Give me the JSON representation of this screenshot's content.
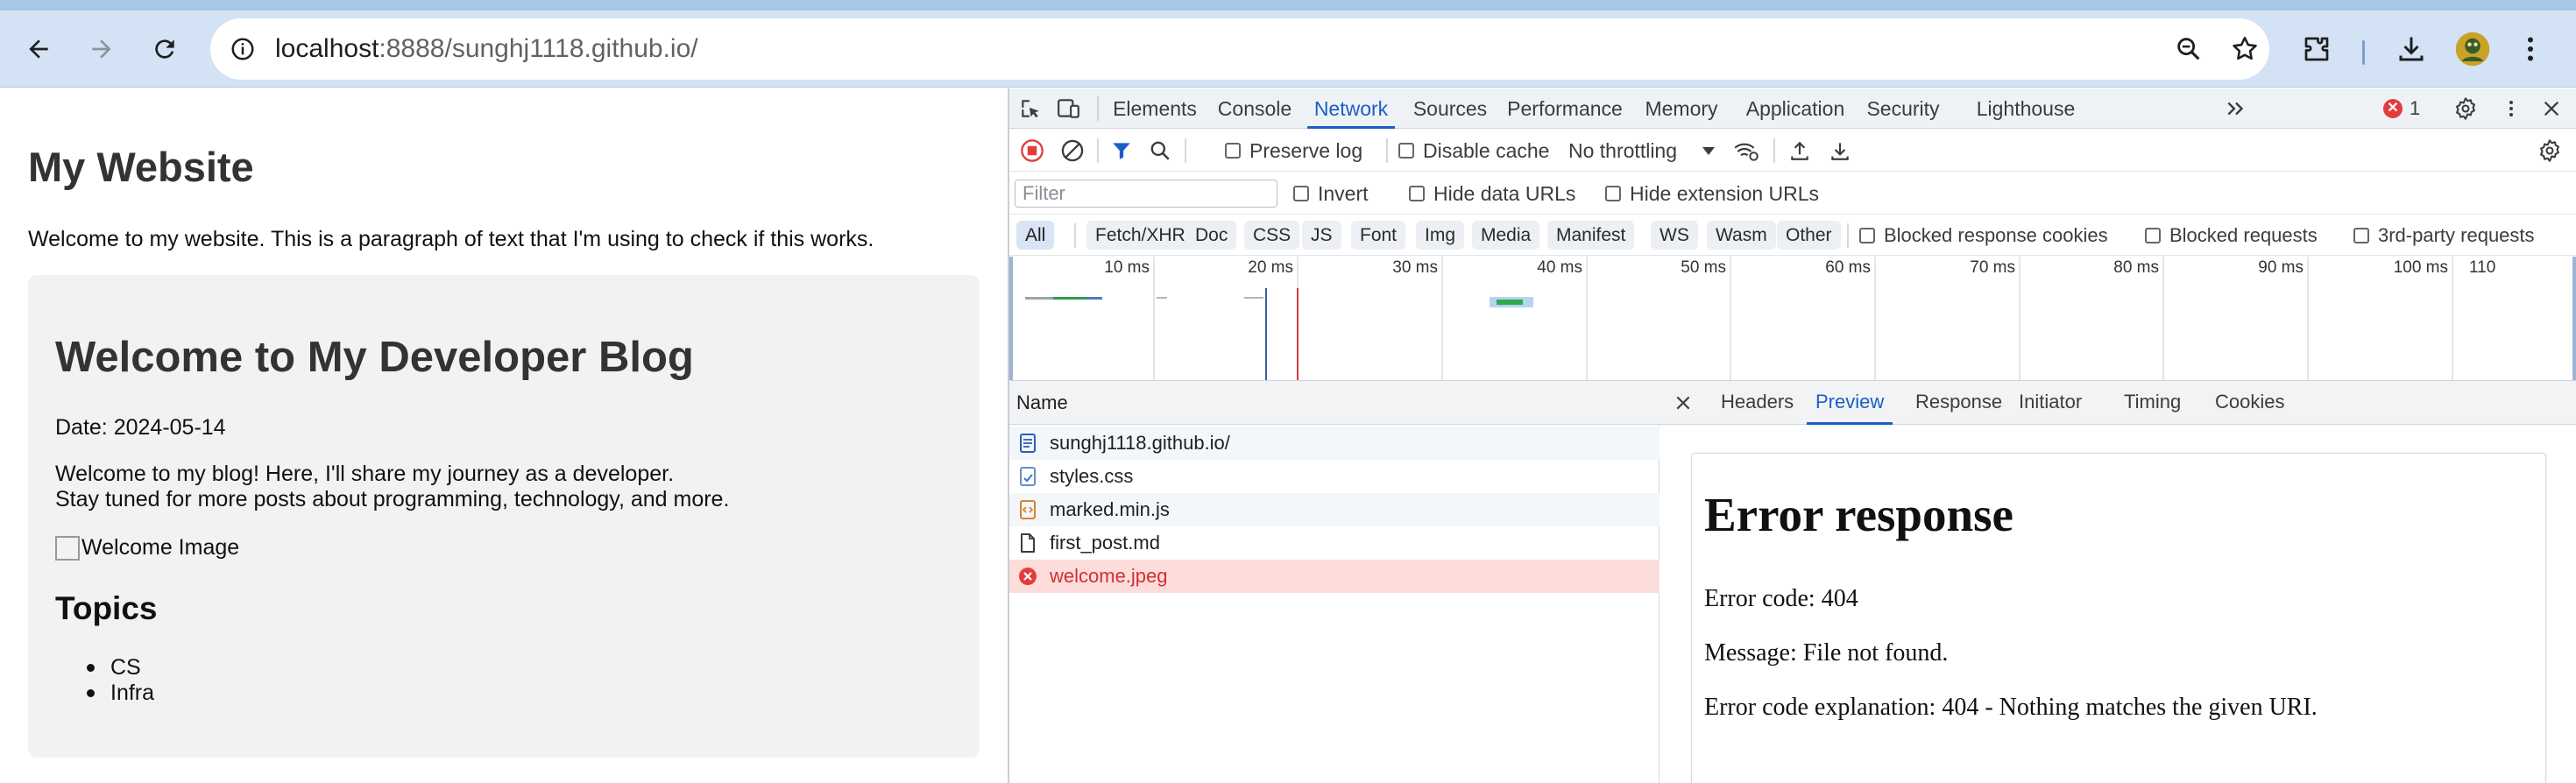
{
  "browser": {
    "url_host": "localhost",
    "url_rest": ":8888/sunghj1118.github.io/"
  },
  "page": {
    "heading": "My Website",
    "intro": "Welcome to my website. This is a paragraph of text that I'm using to check if this works.",
    "blog": {
      "title": "Welcome to My Developer Blog",
      "date": "Date: 2024-05-14",
      "paragraph_line1": "Welcome to my blog! Here, I'll share my journey as a developer.",
      "paragraph_line2": "Stay tuned for more posts about programming, technology, and more.",
      "image_alt": "Welcome Image",
      "topics_title": "Topics",
      "topics": [
        "CS",
        "Infra"
      ]
    }
  },
  "devtools": {
    "tabs": [
      "Elements",
      "Console",
      "Network",
      "Sources",
      "Performance",
      "Memory",
      "Application",
      "Security",
      "Lighthouse"
    ],
    "active_tab": "Network",
    "error_count": "1",
    "toolbar": {
      "preserve_log": "Preserve log",
      "disable_cache": "Disable cache",
      "throttling": "No throttling"
    },
    "filter": {
      "placeholder": "Filter",
      "invert": "Invert",
      "hide_data_urls": "Hide data URLs",
      "hide_extension_urls": "Hide extension URLs"
    },
    "types": [
      "All",
      "Fetch/XHR",
      "Doc",
      "CSS",
      "JS",
      "Font",
      "Img",
      "Media",
      "Manifest",
      "WS",
      "Wasm",
      "Other"
    ],
    "blocked": {
      "cookies": "Blocked response cookies",
      "requests": "Blocked requests",
      "third_party": "3rd-party requests"
    },
    "overview_ticks": [
      "10 ms",
      "20 ms",
      "30 ms",
      "40 ms",
      "50 ms",
      "60 ms",
      "70 ms",
      "80 ms",
      "90 ms",
      "100 ms",
      "110"
    ],
    "table": {
      "name_header": "Name",
      "rows": [
        {
          "name": "sunghj1118.github.io/",
          "icon": "document-icon"
        },
        {
          "name": "styles.css",
          "icon": "stylesheet-icon"
        },
        {
          "name": "marked.min.js",
          "icon": "script-icon"
        },
        {
          "name": "first_post.md",
          "icon": "file-icon"
        },
        {
          "name": "welcome.jpeg",
          "icon": "error-icon"
        }
      ]
    },
    "detail_tabs": [
      "Headers",
      "Preview",
      "Response",
      "Initiator",
      "Timing",
      "Cookies"
    ],
    "active_detail_tab": "Preview",
    "preview": {
      "heading": "Error response",
      "code": "Error code: 404",
      "message": "Message: File not found.",
      "explanation": "Error code explanation: 404 - Nothing matches the given URI."
    }
  },
  "colors": {
    "accent": "#1a5fc7",
    "error": "#e23d3d",
    "chrome_toolbar": "#d3e3f5"
  }
}
